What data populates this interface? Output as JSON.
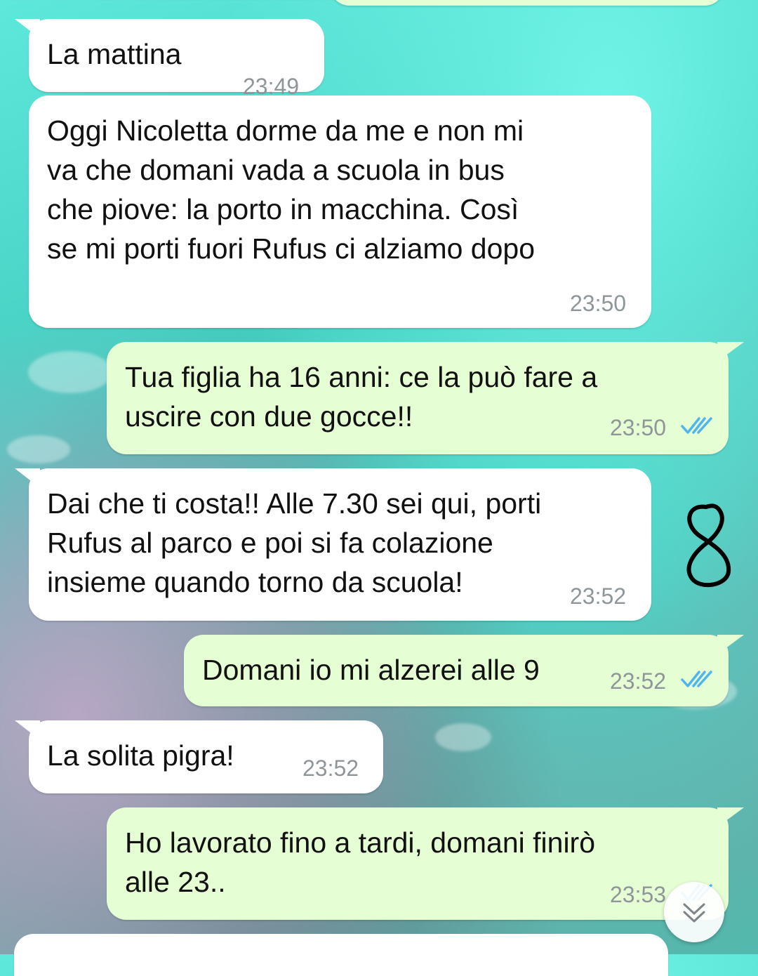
{
  "messages": [
    {
      "direction": "outgoing",
      "text": "",
      "time": ""
    },
    {
      "direction": "incoming",
      "text": "La mattina",
      "time": "23:49"
    },
    {
      "direction": "incoming",
      "text": "Oggi Nicoletta dorme da me e non mi\nva che domani vada a scuola in bus\nche piove: la porto in macchina. Così\nse mi porti fuori Rufus ci alziamo dopo",
      "time": "23:50"
    },
    {
      "direction": "outgoing",
      "text": "Tua figlia ha 16 anni: ce la può fare a\nuscire con due gocce!!",
      "time": "23:50",
      "status": "read"
    },
    {
      "direction": "incoming",
      "text": "Dai che ti costa!! Alle 7.30 sei qui, porti\nRufus al parco e poi si fa colazione\ninsieme quando torno da scuola!",
      "time": "23:52"
    },
    {
      "direction": "outgoing",
      "text": "Domani io mi alzerei alle 9",
      "time": "23:52",
      "status": "read"
    },
    {
      "direction": "incoming",
      "text": "La solita pigra!",
      "time": "23:52"
    },
    {
      "direction": "outgoing",
      "text": "Ho lavorato fino a tardi, domani finirò\nalle 23..",
      "time": "23:53",
      "status": "read"
    }
  ],
  "annotation": {
    "icon": "handwritten-eight-icon",
    "color": "#000000"
  },
  "scroll_button": {
    "icon": "chevron-double-down-icon"
  },
  "colors": {
    "incoming_bubble": "#ffffff",
    "outgoing_bubble": "#e6fed4",
    "timestamp": "#8f969a",
    "read_ticks": "#4fb6ec"
  }
}
